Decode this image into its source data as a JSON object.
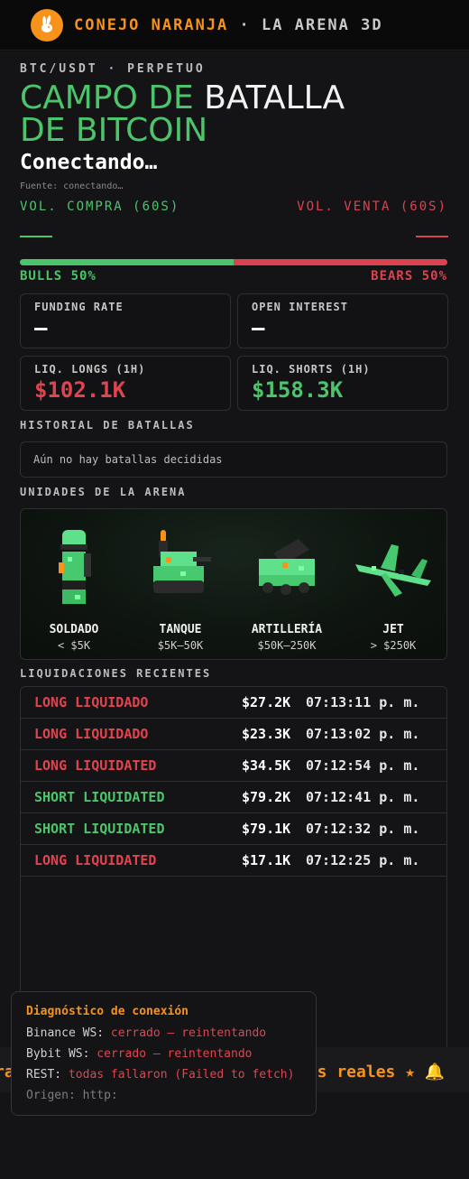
{
  "header": {
    "brand": "CONEJO NARANJA",
    "separator": " · ",
    "subtitle": "LA ARENA 3D",
    "logo_icon": "rabbit-icon"
  },
  "market": {
    "pair": "BTC/USDT · PERPETUO",
    "title_part1": "CAMPO DE",
    "title_part2": "BATALLA",
    "title_part3": "DE BITCOIN",
    "status": "Conectando…",
    "source": "Fuente: conectando…"
  },
  "volume": {
    "buy_label": "VOL. COMPRA (60S)",
    "sell_label": "VOL. VENTA (60S)",
    "buy_value": "—",
    "sell_value": "—"
  },
  "balance": {
    "bulls_label": "BULLS 50%",
    "bears_label": "BEARS 50%",
    "bulls_fraction": 0.5
  },
  "stats": {
    "funding_label": "FUNDING RATE",
    "funding_value": "—",
    "oi_label": "OPEN INTEREST",
    "oi_value": "—",
    "liq_longs_label": "LIQ. LONGS (1H)",
    "liq_longs_value": "$102.1K",
    "liq_shorts_label": "LIQ. SHORTS (1H)",
    "liq_shorts_value": "$158.3K"
  },
  "history": {
    "heading": "HISTORIAL DE BATALLAS",
    "empty_text": "Aún no hay batallas decididas"
  },
  "units": {
    "heading": "UNIDADES DE LA ARENA",
    "items": [
      {
        "name": "SOLDADO",
        "range": "< $5K",
        "icon": "soldier-icon"
      },
      {
        "name": "TANQUE",
        "range": "$5K–50K",
        "icon": "tank-icon"
      },
      {
        "name": "ARTILLERÍA",
        "range": "$50K–250K",
        "icon": "artillery-icon"
      },
      {
        "name": "JET",
        "range": "> $250K",
        "icon": "jet-icon"
      }
    ]
  },
  "liquidations": {
    "heading": "LIQUIDACIONES RECIENTES",
    "rows": [
      {
        "type": "LONG LIQUIDADO",
        "side": "long",
        "amount": "$27.2K",
        "time": "07:13:11 p. m."
      },
      {
        "type": "LONG LIQUIDADO",
        "side": "long",
        "amount": "$23.3K",
        "time": "07:13:02 p. m."
      },
      {
        "type": "LONG LIQUIDATED",
        "side": "long",
        "amount": "$34.5K",
        "time": "07:12:54 p. m."
      },
      {
        "type": "SHORT LIQUIDATED",
        "side": "short",
        "amount": "$79.2K",
        "time": "07:12:41 p. m."
      },
      {
        "type": "SHORT LIQUIDATED",
        "side": "short",
        "amount": "$79.1K",
        "time": "07:12:32 p. m."
      },
      {
        "type": "LONG LIQUIDATED",
        "side": "long",
        "amount": "$17.1K",
        "time": "07:12:25 p. m."
      }
    ]
  },
  "ticker": {
    "left_fragment": "rad",
    "right_fragment": "das reales ★ 🔔"
  },
  "diagnostics": {
    "title": "Diagnóstico de conexión",
    "binance_label": "Binance WS:",
    "binance_status": "cerrado — reintentando",
    "bybit_label": "Bybit WS:",
    "bybit_status": "cerrado — reintentando",
    "rest_label": "REST:",
    "rest_status": "todas fallaron (Failed to fetch)",
    "origin": "Origen: http:"
  },
  "colors": {
    "accent": "#f7931a",
    "bull": "#4cc46b",
    "bear": "#e0444f",
    "background": "#141416"
  }
}
